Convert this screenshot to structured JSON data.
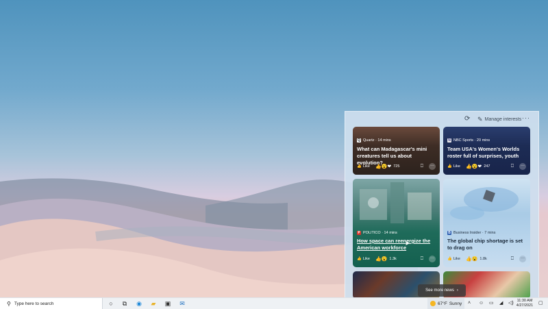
{
  "news_panel": {
    "manage_label": "Manage interests",
    "cards": [
      {
        "source": "Quartz · 14 mins",
        "title": "What can Madagascar's mini creatures tell us about evolution?",
        "like_label": "Like",
        "reaction_count": "725"
      },
      {
        "source": "NBC Sports · 20 mins",
        "title": "Team USA's Women's Worlds roster full of surprises, youth",
        "like_label": "Like",
        "reaction_count": "247"
      },
      {
        "source": "POLITICO · 14 mins",
        "title": "How space can reenergize the American workforce",
        "like_label": "Like",
        "reaction_count": "1.3k"
      },
      {
        "source": "Business Insider · 7 mins",
        "title": "The global chip shortage is set to drag on",
        "like_label": "Like",
        "reaction_count": "1.8k"
      }
    ],
    "see_more_label": "See more news"
  },
  "taskbar": {
    "search_placeholder": "Type here to search",
    "weather": {
      "temp": "67°F",
      "condition": "Sunny"
    },
    "clock": {
      "time": "11:30 AM",
      "date": "4/27/2021"
    }
  }
}
